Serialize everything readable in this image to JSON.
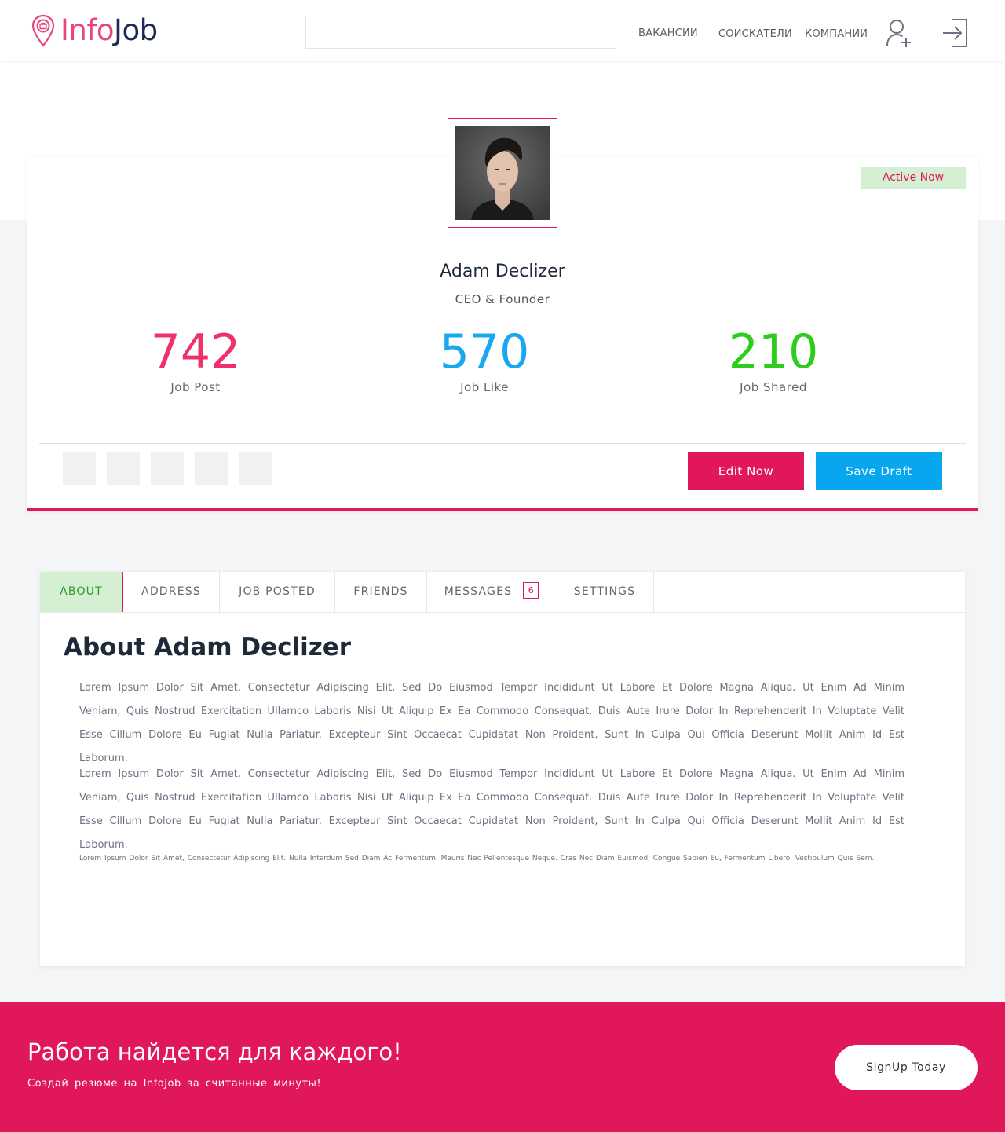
{
  "brand": {
    "info": "Info",
    "job": "Job",
    "pink": "#e8457f",
    "navy": "#1e2a55"
  },
  "search": {
    "value": "",
    "placeholder": ""
  },
  "nav": {
    "vacancies": "ВАКАНСИИ",
    "applicants": "СОИСКАТЕЛИ",
    "companies": "КОМПАНИИ",
    "register_icon": "user-plus-icon",
    "login_icon": "login-icon"
  },
  "profile": {
    "status": "Active Now",
    "name": "Adam Declizer",
    "role": "CEO & Founder",
    "stats": [
      {
        "value": "742",
        "label": "Job Post",
        "color": "#f0306a"
      },
      {
        "value": "570",
        "label": "Job Like",
        "color": "#19a8f0"
      },
      {
        "value": "210",
        "label": "Job Shared",
        "color": "#2ecc1c"
      }
    ],
    "edit_label": "Edit Now",
    "save_label": "Save Draft"
  },
  "tabs": [
    {
      "label": "ABOUT"
    },
    {
      "label": "ADDRESS"
    },
    {
      "label": "JOB POSTED"
    },
    {
      "label": "FRIENDS"
    },
    {
      "label": "MESSAGES",
      "count": "6"
    },
    {
      "label": "SETTINGS"
    }
  ],
  "about": {
    "title": "About Adam Declizer",
    "paragraphs": [
      "Lorem Ipsum Dolor Sit Amet, Consectetur Adipiscing Elit, Sed Do Eiusmod Tempor Incididunt Ut Labore Et Dolore Magna Aliqua. Ut Enim Ad Minim Veniam, Quis Nostrud Exercitation Ullamco Laboris Nisi Ut Aliquip Ex Ea Commodo Consequat. Duis Aute Irure Dolor In Reprehenderit In Voluptate Velit Esse Cillum Dolore Eu Fugiat Nulla Pariatur. Excepteur Sint Occaecat Cupidatat Non Proident, Sunt In Culpa Qui Officia Deserunt Mollit Anim Id Est Laborum.",
      "Lorem Ipsum Dolor Sit Amet, Consectetur Adipiscing Elit, Sed Do Eiusmod Tempor Incididunt Ut Labore Et Dolore Magna Aliqua. Ut Enim Ad Minim Veniam, Quis Nostrud Exercitation Ullamco Laboris Nisi Ut Aliquip Ex Ea Commodo Consequat. Duis Aute Irure Dolor In Reprehenderit In Voluptate Velit Esse Cillum Dolore Eu Fugiat Nulla Pariatur. Excepteur Sint Occaecat Cupidatat Non Proident, Sunt In Culpa Qui Officia Deserunt Mollit Anim Id Est Laborum."
    ],
    "small": "Lorem Ipsum Dolor Sit Amet, Consectetur Adipiscing Elit. Nulla Interdum Sed Diam Ac Fermentum. Mauris Nec Pellentesque Neque. Cras Nec Diam Euismod, Congue Sapien Eu, Fermentum Libero. Vestibulum Quis Sem."
  },
  "footer": {
    "title": "Работа найдется для каждого!",
    "subtitle": "Создай резюме на InfoJob за считанные минуты!",
    "signup_label": "SignUp Today",
    "bg_color": "#e0185a"
  }
}
